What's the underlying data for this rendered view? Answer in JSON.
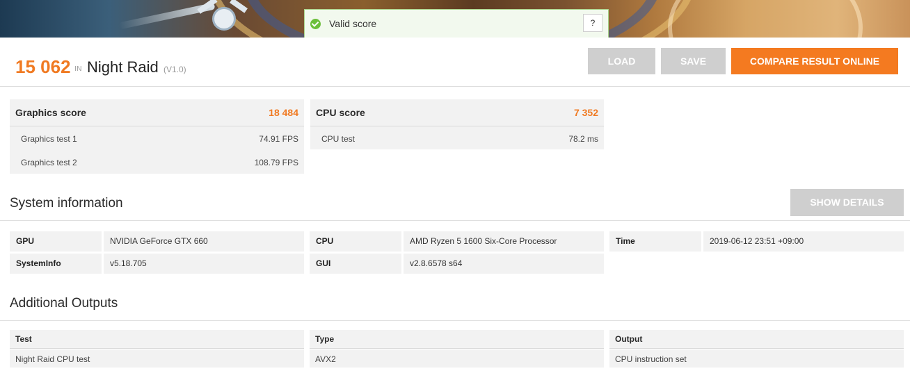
{
  "banner": {
    "status": "Valid score",
    "help_label": "?"
  },
  "header": {
    "score": "15 062",
    "in_label": "IN",
    "benchmark": "Night Raid",
    "version": "(V1.0)",
    "buttons": {
      "load": "LOAD",
      "save": "SAVE",
      "compare": "COMPARE RESULT ONLINE"
    }
  },
  "graphics": {
    "title": "Graphics score",
    "score": "18 484",
    "tests": [
      {
        "label": "Graphics test 1",
        "value": "74.91 FPS"
      },
      {
        "label": "Graphics test 2",
        "value": "108.79 FPS"
      }
    ]
  },
  "cpu": {
    "title": "CPU score",
    "score": "7 352",
    "tests": [
      {
        "label": "CPU test",
        "value": "78.2 ms"
      }
    ]
  },
  "system_info": {
    "title": "System information",
    "show_details": "SHOW DETAILS",
    "rows": [
      {
        "label": "GPU",
        "value": "NVIDIA GeForce GTX 660"
      },
      {
        "label": "SystemInfo",
        "value": "v5.18.705"
      },
      {
        "label": "CPU",
        "value": "AMD Ryzen 5 1600 Six-Core Processor"
      },
      {
        "label": "GUI",
        "value": "v2.8.6578 s64"
      },
      {
        "label": "Time",
        "value": "2019-06-12 23:51 +09:00"
      }
    ]
  },
  "additional": {
    "title": "Additional Outputs",
    "headers": [
      "Test",
      "Type",
      "Output"
    ],
    "rows": [
      [
        "Night Raid CPU test",
        "AVX2",
        "CPU instruction set"
      ]
    ]
  },
  "colors": {
    "accent": "#f47a20",
    "valid": "#6cbf3b",
    "panel_bg": "#f2f2f2",
    "button_disabled": "#cfcfcf"
  }
}
